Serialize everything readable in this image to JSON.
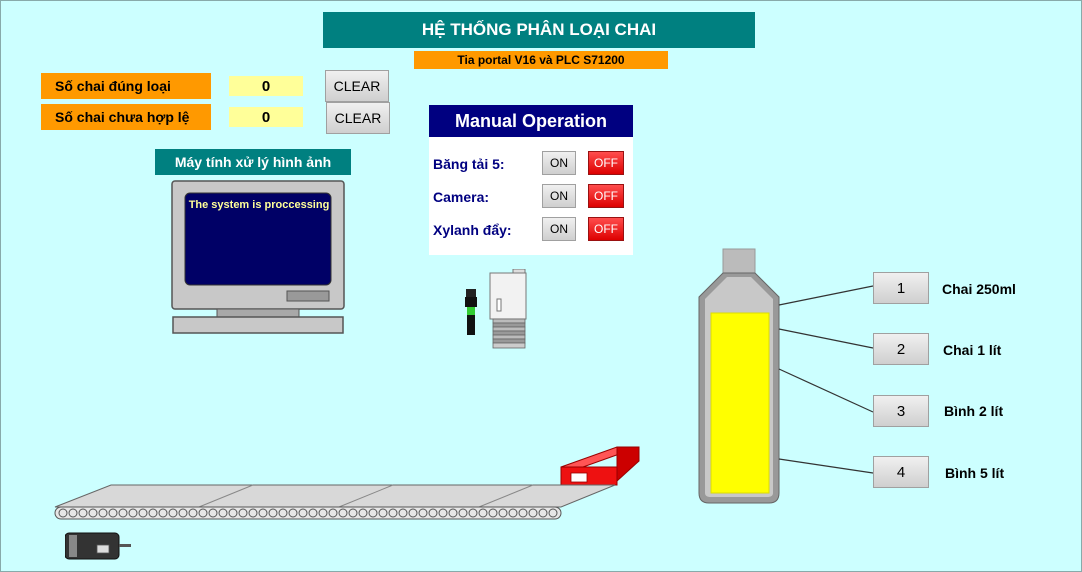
{
  "header": {
    "title": "HỆ THỐNG PHÂN LOẠI CHAI",
    "subtitle": "Tia portal V16 và PLC S71200"
  },
  "counters": [
    {
      "label": "Số chai đúng loại",
      "value": "0",
      "clear_label": "CLEAR"
    },
    {
      "label": "Số chai chưa hợp lệ",
      "value": "0",
      "clear_label": "CLEAR"
    }
  ],
  "pc": {
    "label": "Máy tính xử lý hình ảnh",
    "screen_text": "The system is proccessing",
    "icon": "monitor-icon"
  },
  "manual": {
    "title": "Manual Operation",
    "rows": [
      {
        "label": "Băng tải 5:",
        "on_label": "ON",
        "off_label": "OFF"
      },
      {
        "label": "Camera:",
        "on_label": "ON",
        "off_label": "OFF"
      },
      {
        "label": "Xylanh đẩy:",
        "on_label": "ON",
        "off_label": "OFF"
      }
    ]
  },
  "categories": [
    {
      "number": "1",
      "label": "Chai 250ml"
    },
    {
      "number": "2",
      "label": "Chai 1 lít"
    },
    {
      "number": "3",
      "label": "Bình 2 lít"
    },
    {
      "number": "4",
      "label": "Bình 5 lít"
    }
  ],
  "graphics": {
    "bottle_fill_color": "#ffff00",
    "off_color": "#ee1111",
    "accent_teal": "#008080",
    "accent_orange": "#ff9900",
    "manual_header_color": "#000080",
    "icons": [
      "monitor-icon",
      "sensor-icon",
      "camera-icon",
      "bottle-icon",
      "conveyor-icon",
      "motor-icon",
      "pusher-icon"
    ]
  }
}
